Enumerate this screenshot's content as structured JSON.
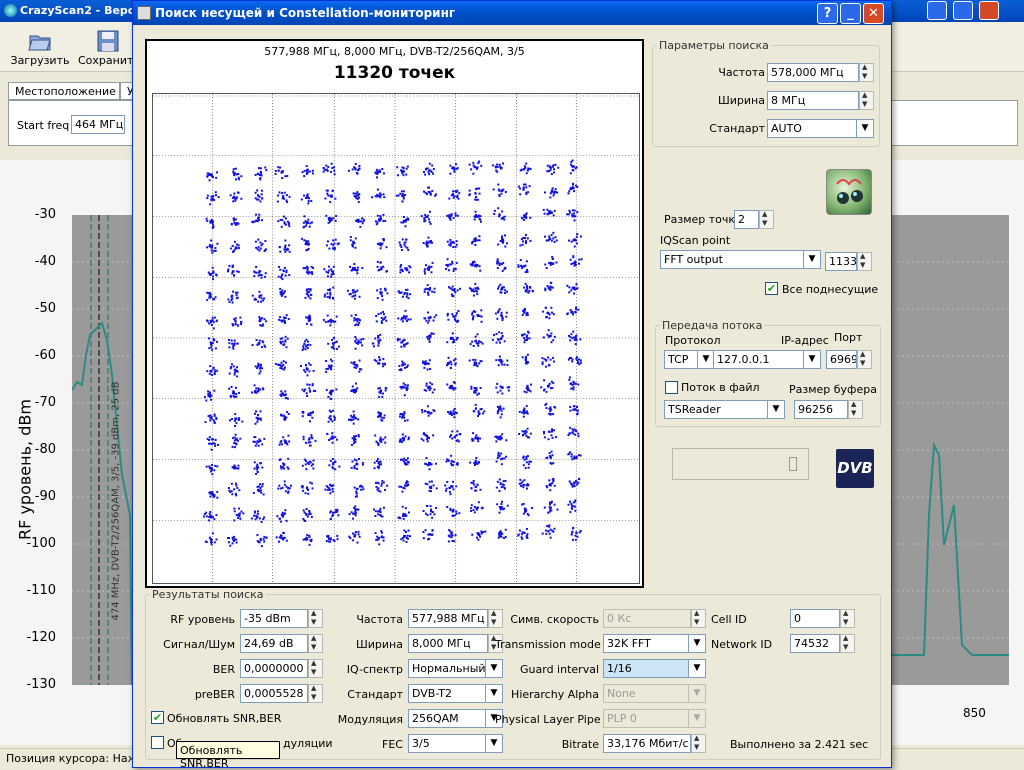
{
  "main": {
    "title": "CrazyScan2 - Версия",
    "toolbar": {
      "load": "Загрузить",
      "save": "Сохранить"
    },
    "tabs": [
      "Местоположение",
      "У"
    ],
    "start_freq_label": "Start freq",
    "start_freq_value": "464 МГц",
    "y_axis_label": "RF уровень, dBm",
    "y_ticks": [
      "-30",
      "-40",
      "-50",
      "-60",
      "-70",
      "-80",
      "-90",
      "-100",
      "-110",
      "-120",
      "-130"
    ],
    "x_tick": "850",
    "marker_label": "474 MHz, DVB-T2/256QAM, 3/5, -39 dBm, 25 dB",
    "status": "Позиция курсора: Нажм"
  },
  "dialog": {
    "title": "Поиск несущей и Constellation-мониторинг",
    "title_buttons": [
      "?",
      "_",
      "✕"
    ],
    "constellation": {
      "subtitle": "577,988 МГц, 8,000 МГц, DVB-T2/256QAM, 3/5",
      "count": "11320 точек"
    },
    "search_params": {
      "legend": "Параметры поиска",
      "freq_label": "Частота",
      "freq_value": "578,000 МГц",
      "width_label": "Ширина",
      "width_value": "8 МГц",
      "std_label": "Стандарт",
      "std_value": "AUTO"
    },
    "point_size_label": "Размер точки",
    "point_size_value": "2",
    "iqscan_label": "IQScan point",
    "iqscan_value": "FFT output",
    "iqscan_num": "1133",
    "all_subcarriers_label": "Все поднесущие",
    "stream": {
      "legend": "Передача потока",
      "protocol_label": "Протокол",
      "ip_label": "IP-адрес",
      "port_label": "Порт",
      "protocol_value": "TCP",
      "ip_value": "127.0.0.1",
      "port_value": "6969",
      "file_label": "Поток в файл",
      "buffer_label": "Размер буфера",
      "reader_value": "TSReader",
      "buffer_value": "96256"
    },
    "dvb_logo": "DVB",
    "results": {
      "legend": "Результаты поиска",
      "rf_label": "RF уровень",
      "rf_value": "-35 dBm",
      "snr_label": "Сигнал/Шум",
      "snr_value": "24,69 dB",
      "ber_label": "BER",
      "ber_value": "0,0000000",
      "preber_label": "preBER",
      "preber_value": "0,0005528",
      "freq_label": "Частота",
      "freq_value": "577,988 МГц",
      "width_label": "Ширина",
      "width_value": "8,000 МГц",
      "iq_label": "IQ-спектр",
      "iq_value": "Нормальный",
      "std_label": "Стандарт",
      "std_value": "DVB-T2",
      "mod_label": "Модуляция",
      "mod_value": "256QAM",
      "fec_label": "FEC",
      "fec_value": "3/5",
      "symrate_label": "Симв. скорость",
      "symrate_value": "0 Кс",
      "tmode_label": "Transmission mode",
      "tmode_value": "32K FFT",
      "guard_label": "Guard interval",
      "guard_value": "1/16",
      "hier_label": "Hierarchy Alpha",
      "hier_value": "None",
      "plp_label": "Physical Layer Pipe",
      "plp_value": "PLP 0",
      "bitrate_label": "Bitrate",
      "bitrate_value": "33,176 Мбит/с",
      "cellid_label": "Cell ID",
      "cellid_value": "0",
      "netid_label": "Network ID",
      "netid_value": "74532",
      "update_snr_label": "Обновлять SNR,BER",
      "update_mod_label": "Об",
      "update_mod_label_tail": "дуляции",
      "done_text": "Выполнено за 2.421 sec"
    },
    "tooltip": "Обновлять SNR,BER"
  },
  "colors": {
    "constellation_points": "#1010e0",
    "spectrum_trace": "#2e8b84",
    "titlebar": "#0050c8"
  }
}
